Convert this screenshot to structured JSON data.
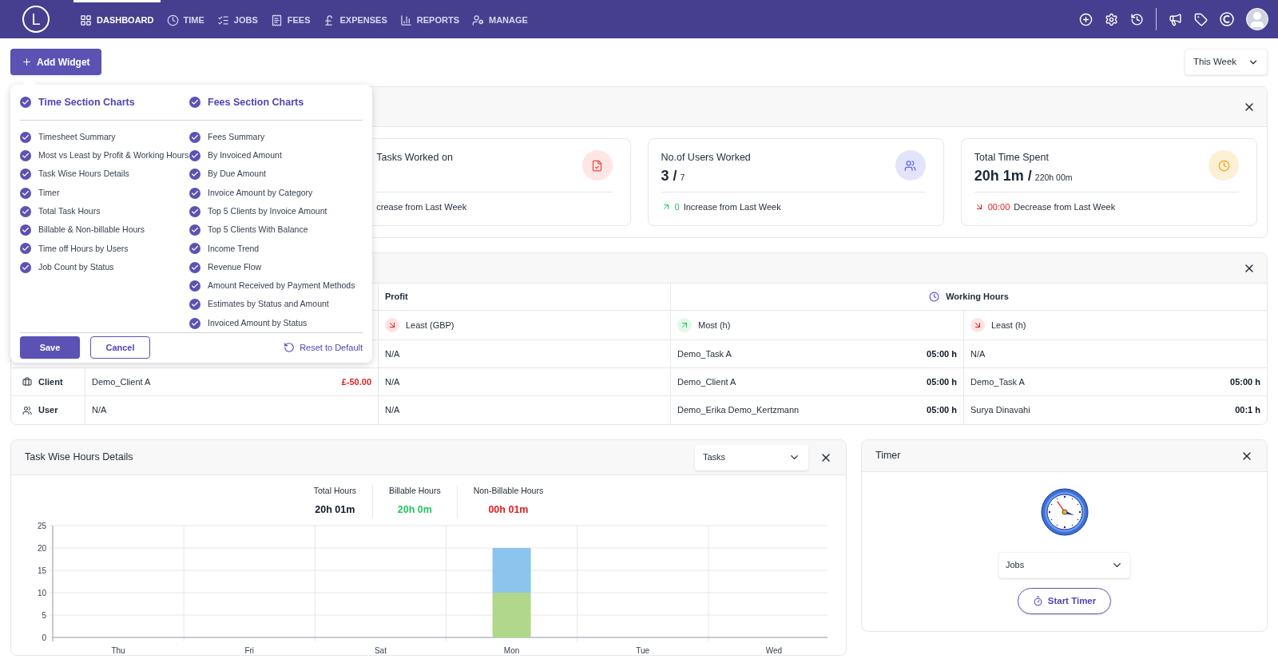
{
  "nav": {
    "logo": "L",
    "items": [
      {
        "label": "DASHBOARD",
        "selected": true
      },
      {
        "label": "TIME",
        "selected": false
      },
      {
        "label": "JOBS",
        "selected": false
      },
      {
        "label": "FEES",
        "selected": false
      },
      {
        "label": "EXPENSES",
        "selected": false
      },
      {
        "label": "REPORTS",
        "selected": false
      },
      {
        "label": "MANAGE",
        "selected": false
      }
    ]
  },
  "toolbar": {
    "add_button": "Add Widget",
    "period": "This Week"
  },
  "widget_picker": {
    "sections": [
      {
        "label": "Time Section Charts",
        "checked": true,
        "items": [
          {
            "label": "Timesheet Summary",
            "checked": true
          },
          {
            "label": "Most vs Least by Profit & Working Hours",
            "checked": true
          },
          {
            "label": "Task Wise Hours Details",
            "checked": true
          },
          {
            "label": "Timer",
            "checked": true
          },
          {
            "label": "Total Task Hours",
            "checked": true
          },
          {
            "label": "Billable & Non-billable Hours",
            "checked": true
          },
          {
            "label": "Time off Hours by Users",
            "checked": true
          },
          {
            "label": "Job Count by Status",
            "checked": true
          }
        ]
      },
      {
        "label": "Fees Section Charts",
        "checked": true,
        "items": [
          {
            "label": "Fees Summary",
            "checked": true
          },
          {
            "label": "By Invoiced Amount",
            "checked": true
          },
          {
            "label": "By Due Amount",
            "checked": true
          },
          {
            "label": "Invoice Amount by Category",
            "checked": true
          },
          {
            "label": "Top 5 Clients by Invoice Amount",
            "checked": true
          },
          {
            "label": "Top 5 Clients With Balance",
            "checked": true
          },
          {
            "label": "Income Trend",
            "checked": true
          },
          {
            "label": "Revenue Flow",
            "checked": true
          },
          {
            "label": "Amount Received by Payment Methods",
            "checked": true
          },
          {
            "label": "Estimates by Status and Amount",
            "checked": true
          },
          {
            "label": "Invoiced Amount by Status",
            "checked": true
          }
        ]
      }
    ],
    "save": "Save",
    "cancel": "Cancel",
    "reset": "Reset to Default"
  },
  "summary_cards": [
    {
      "title": "Tasks Worked on",
      "footer": "crease from Last Week",
      "color": "#fde6e4"
    },
    {
      "title": "No.of Users Worked",
      "value": "3 /",
      "total": "7",
      "change": "0",
      "kind": "increase",
      "footer": "Increase from Last Week",
      "color": "#e3e4fb"
    },
    {
      "title": "Total Time Spent",
      "value": "20h 1m /",
      "total": "220h 00m",
      "change": "00:00",
      "kind": "decrease",
      "footer": "Decrease from Last Week",
      "color": "#fdf0d6"
    }
  ],
  "most_least": {
    "group_headers": [
      {
        "label": "Profit"
      },
      {
        "label": "Working Hours"
      }
    ],
    "columns": [
      {},
      {
        "label": "Least (GBP)",
        "kind": "decrease"
      },
      {
        "label": "Most (h)",
        "kind": "increase"
      },
      {
        "label": "Least (h)",
        "kind": "decrease"
      }
    ],
    "rows": [
      {
        "cells": [
          {},
          {
            "text": "N/A"
          },
          {
            "text": "Demo_Task A",
            "value": "05:00 h"
          },
          {
            "text": "N/A"
          }
        ]
      },
      {
        "label": "Client",
        "cells": [
          {
            "text": "Demo_Client A",
            "value": "£-50.00",
            "kind": "negative"
          },
          {
            "text": "N/A"
          },
          {
            "text": "Demo_Client A",
            "value": "05:00 h"
          },
          {
            "text": "Demo_Task A",
            "value": "05:00 h"
          }
        ]
      },
      {
        "label": "User",
        "cells": [
          {
            "text": "N/A"
          },
          {
            "text": "N/A"
          },
          {
            "text": "Demo_Erika Demo_Kertzmann",
            "value": "05:00 h"
          },
          {
            "text": "Surya Dinavahi",
            "value": "00:1 h"
          }
        ]
      }
    ]
  },
  "task_hours": {
    "title": "Task Wise Hours Details",
    "select": "Tasks",
    "stats": [
      {
        "label": "Total Hours",
        "value": "20h 01m",
        "kind": "neutral"
      },
      {
        "label": "Billable Hours",
        "value": "20h 0m",
        "kind": "positive"
      },
      {
        "label": "Non-Billable Hours",
        "value": "00h 01m",
        "kind": "negative"
      }
    ],
    "chart_data": {
      "type": "bar",
      "stacked": true,
      "grid": true,
      "categories": [
        "Thu",
        "Fri",
        "Sat",
        "Mon",
        "Tue",
        "Wed"
      ],
      "ylim": [
        0,
        25
      ],
      "yticks": [
        0,
        5,
        10,
        15,
        20,
        25
      ],
      "series": [
        {
          "color": "#b1d88a",
          "values": [
            0,
            0,
            0,
            10,
            0,
            0
          ]
        },
        {
          "color": "#8bc4ec",
          "values": [
            0,
            0,
            0,
            10,
            0,
            0
          ]
        }
      ]
    }
  },
  "timer": {
    "title": "Timer",
    "select": "Jobs",
    "button": "Start Timer"
  }
}
